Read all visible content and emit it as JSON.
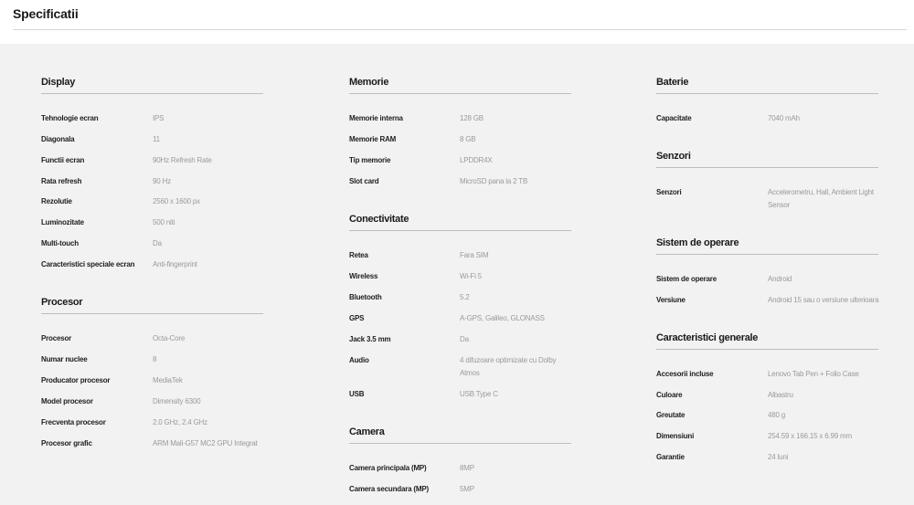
{
  "page": {
    "title": "Specificatii"
  },
  "sections": {
    "display": {
      "title": "Display",
      "rows": [
        {
          "label": "Tehnologie ecran",
          "value": "IPS"
        },
        {
          "label": "Diagonala",
          "value": "11"
        },
        {
          "label": "Functii ecran",
          "value": "90Hz Refresh Rate"
        },
        {
          "label": "Rata refresh",
          "value": "90 Hz"
        },
        {
          "label": "Rezolutie",
          "value": "2560 x 1600 px"
        },
        {
          "label": "Luminozitate",
          "value": "500 niti"
        },
        {
          "label": "Multi-touch",
          "value": "Da"
        },
        {
          "label": "Caracteristici speciale ecran",
          "value": "Anti-fingerprint"
        }
      ]
    },
    "procesor": {
      "title": "Procesor",
      "rows": [
        {
          "label": "Procesor",
          "value": "Octa-Core"
        },
        {
          "label": "Numar nuclee",
          "value": "8"
        },
        {
          "label": "Producator procesor",
          "value": "MediaTek"
        },
        {
          "label": "Model procesor",
          "value": "Dimensity 6300"
        },
        {
          "label": "Frecventa procesor",
          "value": "2.0 GHz, 2.4 GHz"
        },
        {
          "label": "Procesor grafic",
          "value": "ARM Mali-G57 MC2 GPU Integrat"
        }
      ]
    },
    "memorie": {
      "title": "Memorie",
      "rows": [
        {
          "label": "Memorie interna",
          "value": "128 GB"
        },
        {
          "label": "Memorie RAM",
          "value": "8 GB"
        },
        {
          "label": "Tip memorie",
          "value": "LPDDR4X"
        },
        {
          "label": "Slot card",
          "value": "MicroSD pana la 2 TB"
        }
      ]
    },
    "conectivitate": {
      "title": "Conectivitate",
      "rows": [
        {
          "label": "Retea",
          "value": "Fara SIM"
        },
        {
          "label": "Wireless",
          "value": "Wi-Fi 5"
        },
        {
          "label": "Bluetooth",
          "value": "5.2"
        },
        {
          "label": "GPS",
          "value": "A-GPS, Galileo, GLONASS"
        },
        {
          "label": "Jack 3.5 mm",
          "value": "Da"
        },
        {
          "label": "Audio",
          "value": "4 difuzoare optimizate cu Dolby Atmos"
        },
        {
          "label": "USB",
          "value": "USB Type C"
        }
      ]
    },
    "camera": {
      "title": "Camera",
      "rows": [
        {
          "label": "Camera principala (MP)",
          "value": "8MP"
        },
        {
          "label": "Camera secundara (MP)",
          "value": "5MP"
        }
      ]
    },
    "baterie": {
      "title": "Baterie",
      "rows": [
        {
          "label": "Capacitate",
          "value": "7040 mAh"
        }
      ]
    },
    "senzori": {
      "title": "Senzori",
      "rows": [
        {
          "label": "Senzori",
          "value": "Accelerometru, Hall, Ambient Light Sensor"
        }
      ]
    },
    "sistem_operare": {
      "title": "Sistem de operare",
      "rows": [
        {
          "label": "Sistem de operare",
          "value": "Android"
        },
        {
          "label": "Versiune",
          "value": "Android 15 sau o versiune ulterioara"
        }
      ]
    },
    "caracteristici_generale": {
      "title": "Caracteristici generale",
      "rows": [
        {
          "label": "Accesorii incluse",
          "value": "Lenovo Tab Pen + Folio Case"
        },
        {
          "label": "Culoare",
          "value": "Albastru"
        },
        {
          "label": "Greutate",
          "value": "480 g"
        },
        {
          "label": "Dimensiuni",
          "value": "254.59 x 166.15 x 6.99 mm"
        },
        {
          "label": "Garantie",
          "value": "24 luni"
        }
      ]
    }
  }
}
